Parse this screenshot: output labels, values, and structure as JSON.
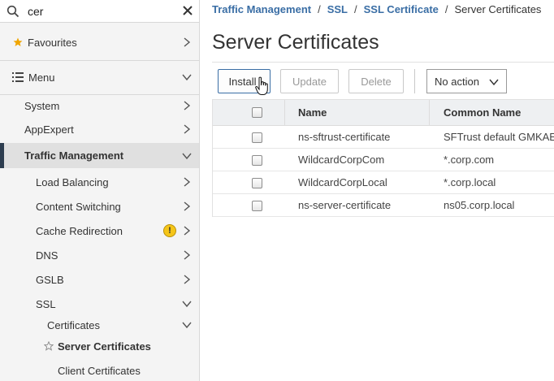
{
  "search": {
    "value": "cer"
  },
  "sidebar": {
    "favourites": "Favourites",
    "menu": "Menu",
    "items": [
      {
        "label": "System"
      },
      {
        "label": "AppExpert"
      },
      {
        "label": "Traffic Management"
      },
      {
        "label": "Load Balancing"
      },
      {
        "label": "Content Switching"
      },
      {
        "label": "Cache Redirection",
        "badge": "!"
      },
      {
        "label": "DNS"
      },
      {
        "label": "GSLB"
      },
      {
        "label": "SSL"
      },
      {
        "label": "Certificates"
      },
      {
        "label": "Server Certificates"
      },
      {
        "label": "Client Certificates"
      }
    ]
  },
  "breadcrumb": {
    "items": [
      "Traffic Management",
      "SSL",
      "SSL Certificate"
    ],
    "current": "Server Certificates",
    "separator": "/"
  },
  "page": {
    "title": "Server Certificates"
  },
  "toolbar": {
    "install": "Install",
    "update": "Update",
    "delete": "Delete",
    "action_select": "No action"
  },
  "table": {
    "columns": [
      "Name",
      "Common Name"
    ],
    "rows": [
      {
        "name": "ns-sftrust-certificate",
        "common_name": "SFTrust default GMKAEO"
      },
      {
        "name": "WildcardCorpCom",
        "common_name": "*.corp.com"
      },
      {
        "name": "WildcardCorpLocal",
        "common_name": "*.corp.local"
      },
      {
        "name": "ns-server-certificate",
        "common_name": "ns05.corp.local"
      }
    ]
  },
  "colors": {
    "accent": "#3a6ea5",
    "sidebar_active_bar": "#2d3d4f",
    "warning": "#f5c518",
    "star": "#f0a500"
  }
}
